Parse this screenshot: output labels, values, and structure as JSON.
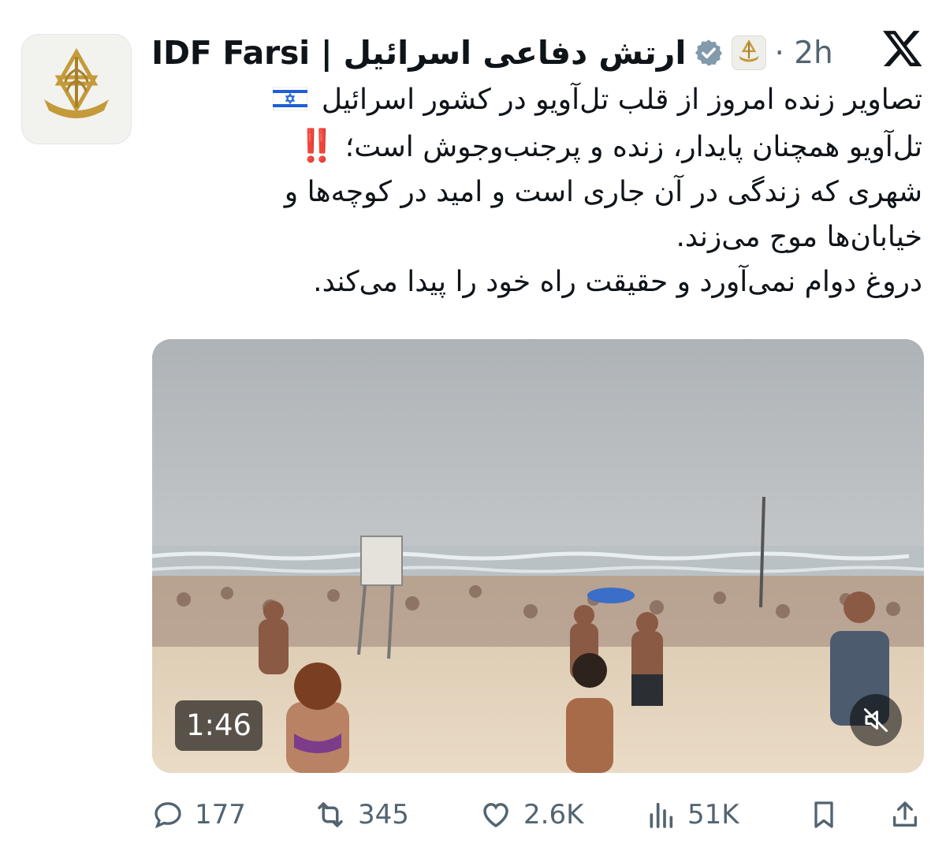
{
  "author": {
    "display_name": "IDF Farsi | ارتش دفاعی اسرائیل",
    "time": "2h",
    "verified": true,
    "affiliate_badge": "idf-emblem-icon",
    "avatar": "idf-emblem-icon"
  },
  "platform": {
    "logo": "x-logo-icon"
  },
  "tweet": {
    "line1": "تصاویر زنده امروز از قلب تل‌آویو در کشور اسرائیل",
    "line1_emoji": "israel-flag-icon",
    "line2": "تل‌آویو همچنان پایدار، زنده و پرجنب‌وجوش است؛",
    "line2_emoji": "‼️",
    "line3": "شهری که زندگی در آن جاری است و امید در کوچه‌ها و",
    "line4": "خیابان‌ها موج می‌زند.",
    "line5": "دروغ دوام نمی‌آورد و حقیقت راه خود را پیدا می‌کند."
  },
  "media": {
    "type": "video",
    "duration": "1:46",
    "muted": true
  },
  "actions": {
    "replies": "177",
    "reposts": "345",
    "likes": "2.6K",
    "views": "51K"
  },
  "colors": {
    "text": "#0f1419",
    "secondary": "#536471",
    "verified": "#829aab",
    "emblem_gold": "#c49a3a"
  }
}
